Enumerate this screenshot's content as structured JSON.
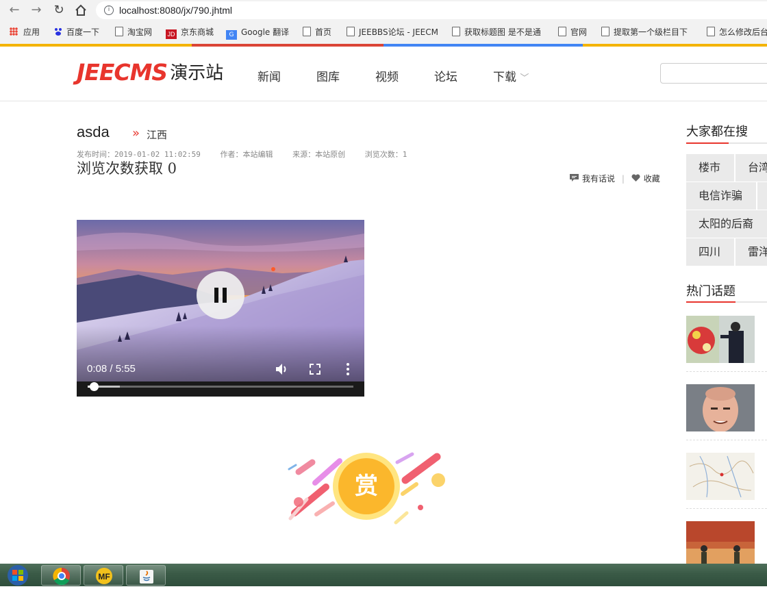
{
  "browser": {
    "url": "localhost:8080/jx/790.jhtml",
    "bookmarks": [
      {
        "label": "应用",
        "icon": "apps-icon"
      },
      {
        "label": "百度一下",
        "icon": "baidu-icon"
      },
      {
        "label": "淘宝网",
        "icon": "page-icon"
      },
      {
        "label": "京东商城",
        "icon": "jd-icon"
      },
      {
        "label": "Google 翻译",
        "icon": "google-translate-icon"
      },
      {
        "label": "首页",
        "icon": "page-icon"
      },
      {
        "label": "JEEBBS论坛 - JEECM",
        "icon": "page-icon"
      },
      {
        "label": "获取标题图 是不是通",
        "icon": "page-icon"
      },
      {
        "label": "官网",
        "icon": "page-icon"
      },
      {
        "label": "提取第一个级栏目下",
        "icon": "page-icon"
      },
      {
        "label": "怎么修改后台",
        "icon": "page-icon"
      }
    ]
  },
  "site": {
    "logo_brand": "JEECMS",
    "logo_sub": "演示站",
    "nav": [
      "新闻",
      "图库",
      "视频",
      "论坛",
      "下载"
    ],
    "nav_dropdown_glyph": "﹀"
  },
  "article": {
    "title": "asda",
    "chevrons": "»",
    "category": "江西",
    "meta": {
      "published": "发布时间：2019-01-02 11:02:59",
      "author": "作者：本站编辑",
      "source": "来源：本站原创",
      "views": "浏览次数：1"
    },
    "views_line": "浏览次数获取 0",
    "comment_label": "我有话说",
    "separator": "|",
    "favorite_label": "收藏"
  },
  "video": {
    "time": "0:08 / 5:55",
    "state": "playing",
    "played_fraction": 0.023,
    "buffered_fraction": 0.12
  },
  "reward": {
    "label": "赏"
  },
  "sidebar": {
    "search_title": "大家都在搜",
    "tags": [
      "楼市",
      "台湾",
      "电信诈骗",
      "太阳的后裔",
      "四川",
      "雷洋"
    ],
    "hot_title": "热门话题"
  },
  "colors": {
    "brand_red": "#e8352d",
    "reward_gold": "#fbb72c"
  }
}
